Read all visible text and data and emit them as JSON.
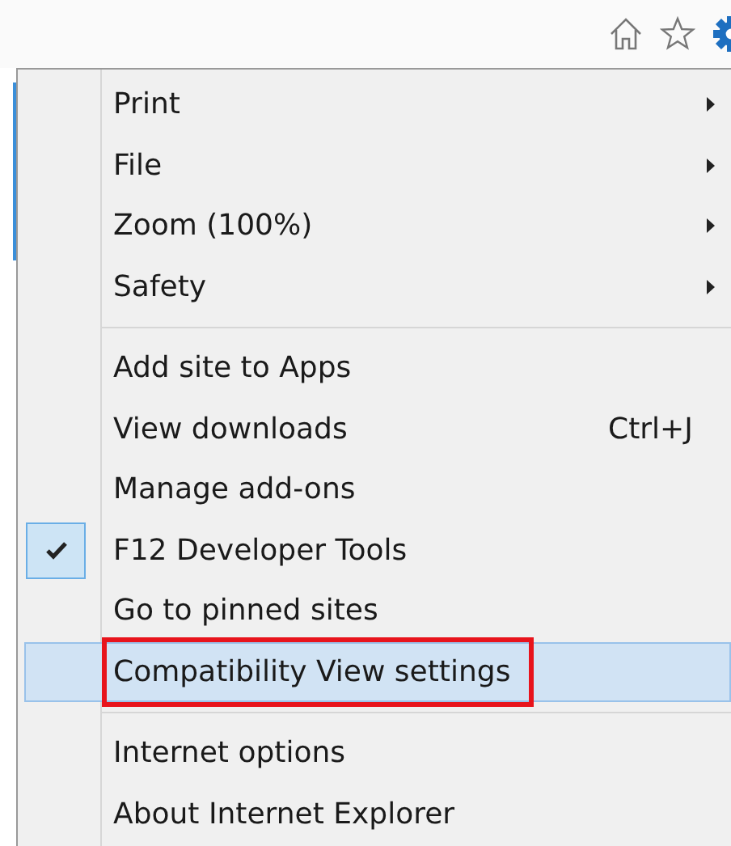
{
  "menu": {
    "items": [
      {
        "kind": "item",
        "label": "Print",
        "submenu": true,
        "checked": false,
        "selected": false,
        "annotated": false
      },
      {
        "kind": "item",
        "label": "File",
        "submenu": true,
        "checked": false,
        "selected": false,
        "annotated": false
      },
      {
        "kind": "item",
        "label": "Zoom (100%)",
        "submenu": true,
        "checked": false,
        "selected": false,
        "annotated": false
      },
      {
        "kind": "item",
        "label": "Safety",
        "submenu": true,
        "checked": false,
        "selected": false,
        "annotated": false
      },
      {
        "kind": "separator"
      },
      {
        "kind": "item",
        "label": "Add site to Apps",
        "submenu": false,
        "checked": false,
        "selected": false,
        "annotated": false
      },
      {
        "kind": "item",
        "label": "View downloads",
        "shortcut": "Ctrl+J",
        "submenu": false,
        "checked": false,
        "selected": false,
        "annotated": false
      },
      {
        "kind": "item",
        "label": "Manage add-ons",
        "submenu": false,
        "checked": false,
        "selected": false,
        "annotated": false
      },
      {
        "kind": "item",
        "label": "F12 Developer Tools",
        "submenu": false,
        "checked": true,
        "selected": false,
        "annotated": false
      },
      {
        "kind": "item",
        "label": "Go to pinned sites",
        "submenu": false,
        "checked": false,
        "selected": false,
        "annotated": false
      },
      {
        "kind": "item",
        "label": "Compatibility View settings",
        "submenu": false,
        "checked": false,
        "selected": true,
        "annotated": true
      },
      {
        "kind": "separator"
      },
      {
        "kind": "item",
        "label": "Internet options",
        "submenu": false,
        "checked": false,
        "selected": false,
        "annotated": false
      },
      {
        "kind": "item",
        "label": "About Internet Explorer",
        "submenu": false,
        "checked": false,
        "selected": false,
        "annotated": false
      }
    ]
  }
}
